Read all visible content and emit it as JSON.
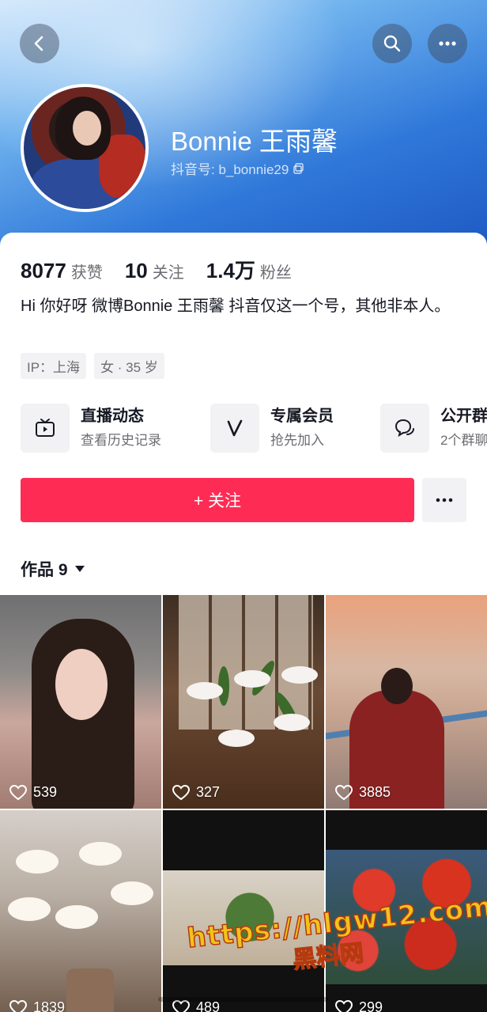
{
  "profile": {
    "name": "Bonnie 王雨馨",
    "douyin_id_label": "抖音号: b_bonnie29"
  },
  "stats": [
    {
      "value": "8077",
      "label": "获赞"
    },
    {
      "value": "10",
      "label": "关注"
    },
    {
      "value": "1.4万",
      "label": "粉丝"
    }
  ],
  "bio": "Hi 你好呀 微博Bonnie 王雨馨 抖音仅这一个号，其他非本人。",
  "tags": [
    "IP：上海",
    "女 · 35 岁"
  ],
  "features": [
    {
      "title": "直播动态",
      "subtitle": "查看历史记录",
      "icon": "tv-icon"
    },
    {
      "title": "专属会员",
      "subtitle": "抢先加入",
      "icon": "v-icon"
    },
    {
      "title": "公开群",
      "subtitle": "2个群聊",
      "icon": "chat-icon"
    }
  ],
  "actions": {
    "follow_label": "+ 关注"
  },
  "works": {
    "label": "作品 9",
    "items": [
      {
        "likes": "539"
      },
      {
        "likes": "327"
      },
      {
        "likes": "3885"
      },
      {
        "likes": "1839"
      },
      {
        "likes": "489"
      },
      {
        "likes": "299"
      }
    ]
  },
  "watermark": {
    "url": "https://hlgw12.com",
    "text": "黑料网"
  },
  "colors": {
    "follow": "#fe2c55",
    "header": "#2f78d9"
  }
}
